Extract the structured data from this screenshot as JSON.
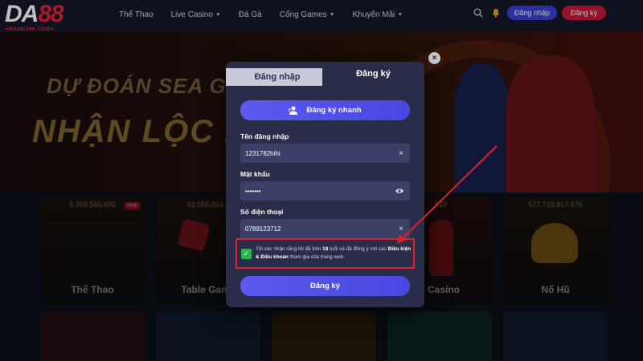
{
  "header": {
    "logo": {
      "brand_left": "DA",
      "brand_right": "88",
      "tagline": "⇒DA88LINK.COM⇐"
    },
    "nav": [
      {
        "label": "Thể Thao",
        "has_chevron": false
      },
      {
        "label": "Live Casino",
        "has_chevron": true
      },
      {
        "label": "Đá Gà",
        "has_chevron": false
      },
      {
        "label": "Cổng Games",
        "has_chevron": true
      },
      {
        "label": "Khuyến Mãi",
        "has_chevron": true
      }
    ],
    "search_icon": "search-icon",
    "notification_icon": "bell-icon",
    "login_label": "Đăng nhập",
    "register_label": "Đăng ký"
  },
  "banner": {
    "line1": "DỰ ĐOÁN SEA GAMES",
    "line2": "NHẬN LỘC 2"
  },
  "cards": [
    {
      "amount": "5.359.565.695",
      "title": "Thể Thao",
      "hot": "Hot"
    },
    {
      "amount": "92.055.854.3",
      "title": "Table Game",
      "hot": ""
    },
    {
      "amount": "",
      "title": "",
      "hot": ""
    },
    {
      "amount": ".519",
      "title": "e Casino",
      "hot": ""
    },
    {
      "amount": "577.719.817.676",
      "title": "Nổ Hũ",
      "hot": ""
    }
  ],
  "modal": {
    "tab_login": "Đăng nhập",
    "tab_register": "Đăng ký",
    "quick_register_label": "Đăng ký nhanh",
    "username_label": "Tên đăng nhập",
    "username_value": "1231782hihi",
    "password_label": "Mật khẩu",
    "password_value": "•••••••",
    "phone_label": "Số điện thoại",
    "phone_value": "0789123712",
    "consent_part1": "Tôi xác nhận rằng tôi đã trên ",
    "consent_age": "18",
    "consent_part2": " tuổi và đã đồng ý với các ",
    "consent_terms": "Điều kiện & Điều khoản",
    "consent_part3": " tham gia của trang web.",
    "submit_label": "Đăng ký",
    "close_symbol": "×",
    "clear_symbol": "×",
    "eye_icon": "eye-icon",
    "check_symbol": "✓"
  },
  "colors": {
    "accent": "#4f4fe8",
    "brand_red": "#e8213a",
    "modal_bg": "#2a2d4a",
    "field_bg": "#3c4066",
    "checkbox": "#2cb54b",
    "highlight": "#e0202a"
  }
}
